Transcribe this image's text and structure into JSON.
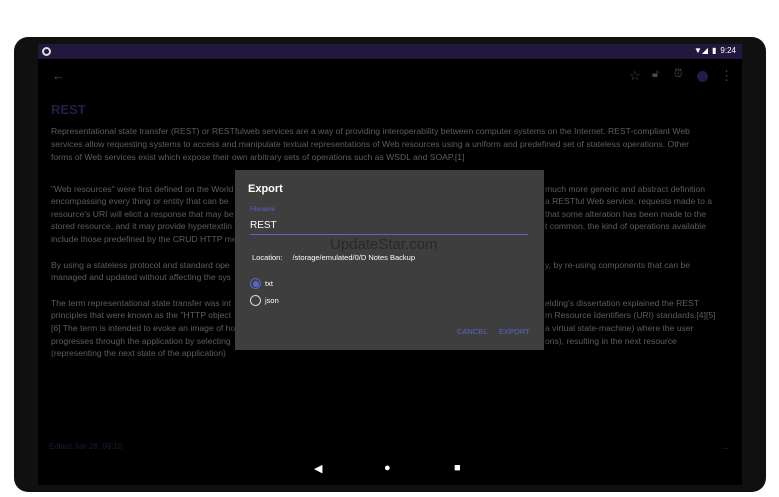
{
  "status": {
    "time": "9:24"
  },
  "note": {
    "title": "REST",
    "p1": [
      "Representational state transfer (REST) or RESTfulweb services are a way of providing interoperability between computer systems on the Internet. REST-compliant Web",
      "services allow requesting systems to access and manipulate textual representations of Web resources using a uniform and predefined set of stateless operations. Other",
      "forms of Web services exist which expose their own arbitrary sets of operations such as WSDL and SOAP.[1]"
    ],
    "left": [
      "\"Web resources\" were first defined on the World",
      "encompassing every thing or entity that can be",
      "resource's URI will elicit a response that may be",
      "stored resource, and it may provide hypertextlin",
      "include those predefined by the CRUD HTTP me",
      "By using a stateless protocol and standard ope",
      "managed and updated without affecting the sys",
      "The term representational state transfer was int",
      "principles that were known as the \"HTTP object",
      "[6] The term is intended to evoke an image of ho",
      "progresses through the application by selecting",
      "(representing the next state of the application)"
    ],
    "right": [
      "much more generic and abstract definition",
      "a RESTful Web service, requests made to a",
      "that some alteration has been made to the",
      "t common, the kind of operations available",
      "y, by re-using components that can be",
      "elding's dissertation explained the REST",
      "m Resource Identifiers (URI) standards.[4][5]",
      "a virtual state-machine) where the user",
      "ons), resulting in the next resource"
    ],
    "edited": "Edited  Jun 28, 09:10",
    "more": "..."
  },
  "dialog": {
    "title": "Export",
    "filename_label": "Filename",
    "filename_value": "REST",
    "location_label": "Location:",
    "location_value": "/storage/emulated/0/D Notes Backup",
    "formats": [
      {
        "label": "txt",
        "selected": true
      },
      {
        "label": "json",
        "selected": false
      }
    ],
    "cancel": "CANCEL",
    "export": "EXPORT",
    "watermark": "UpdateStar.com"
  }
}
